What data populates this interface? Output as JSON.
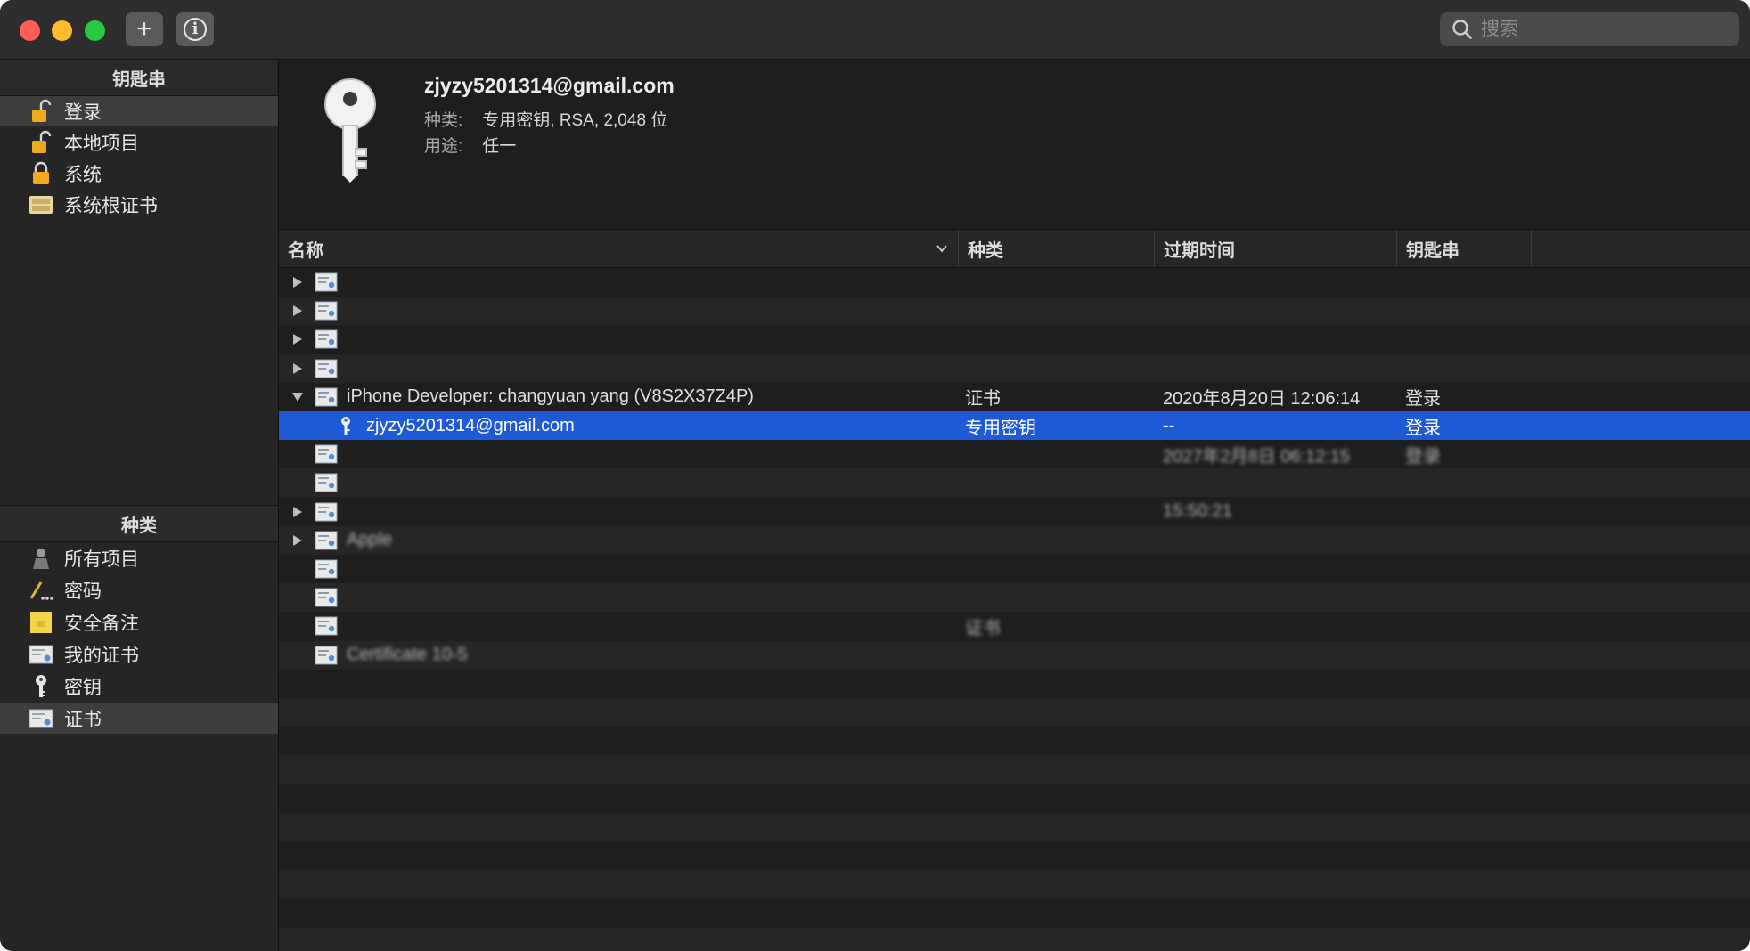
{
  "toolbar": {
    "add_label": "+",
    "info_label": "i",
    "search_placeholder": "搜索"
  },
  "sidebar": {
    "keychains_header": "钥匙串",
    "keychains": [
      {
        "label": "登录",
        "icon": "unlocked-padlock-icon"
      },
      {
        "label": "本地项目",
        "icon": "unlocked-padlock-icon"
      },
      {
        "label": "系统",
        "icon": "locked-padlock-icon"
      },
      {
        "label": "系统根证书",
        "icon": "certificate-cabinet-icon"
      }
    ],
    "categories_header": "种类",
    "categories": [
      {
        "label": "所有项目",
        "icon": "person-icon"
      },
      {
        "label": "密码",
        "icon": "pen-dots-icon"
      },
      {
        "label": "安全备注",
        "icon": "note-icon"
      },
      {
        "label": "我的证书",
        "icon": "certificate-icon"
      },
      {
        "label": "密钥",
        "icon": "key-icon"
      },
      {
        "label": "证书",
        "icon": "certificate-icon"
      }
    ],
    "selected_keychain": "登录",
    "selected_category": "证书"
  },
  "detail": {
    "name": "zjyzy5201314@gmail.com",
    "kind_label": "种类:",
    "kind_value": "专用密钥, RSA, 2,048 位",
    "usage_label": "用途:",
    "usage_value": "任一"
  },
  "table": {
    "columns": [
      "名称",
      "种类",
      "过期时间",
      "钥匙串"
    ],
    "rows": [
      {
        "disclosure": "collapsed",
        "name": "",
        "kind": "",
        "expires": "",
        "keychain": "",
        "blurred": true
      },
      {
        "disclosure": "collapsed",
        "name": "",
        "kind": "",
        "expires": "",
        "keychain": "",
        "blurred": true
      },
      {
        "disclosure": "collapsed",
        "name": "",
        "kind": "",
        "expires": "",
        "keychain": "",
        "blurred": true
      },
      {
        "disclosure": "collapsed",
        "name": "",
        "kind": "",
        "expires": "",
        "keychain": "",
        "blurred": true
      },
      {
        "disclosure": "expanded",
        "name": "iPhone Developer: changyuan yang (V8S2X37Z4P)",
        "kind": "证书",
        "expires": "2020年8月20日 12:06:14",
        "keychain": "登录",
        "blurred": false
      },
      {
        "disclosure": "none",
        "child": true,
        "name": "zjyzy5201314@gmail.com",
        "kind": "专用密钥",
        "expires": "--",
        "keychain": "登录",
        "blurred": false,
        "selected": true
      },
      {
        "disclosure": "none",
        "name": "",
        "kind": "",
        "expires": "2027年2月8日 06:12:15",
        "keychain": "登录",
        "blurred": true
      },
      {
        "disclosure": "none",
        "name": "",
        "kind": "",
        "expires": "",
        "keychain": "",
        "blurred": true
      },
      {
        "disclosure": "collapsed",
        "name": "",
        "kind": "",
        "expires": "15:50:21",
        "keychain": "",
        "blurred": true
      },
      {
        "disclosure": "collapsed",
        "name": "Apple",
        "kind": "",
        "expires": "",
        "keychain": "",
        "blurred": true
      },
      {
        "disclosure": "none",
        "name": "",
        "kind": "",
        "expires": "",
        "keychain": "",
        "blurred": true
      },
      {
        "disclosure": "none",
        "name": "",
        "kind": "",
        "expires": "",
        "keychain": "",
        "blurred": true
      },
      {
        "disclosure": "none",
        "name": "",
        "kind": "证书",
        "expires": "",
        "keychain": "",
        "blurred": true
      },
      {
        "disclosure": "none",
        "name": "Certificate 10-5",
        "kind": "",
        "expires": "",
        "keychain": "",
        "blurred": true
      }
    ]
  },
  "colors": {
    "selection": "#1f5ad6",
    "close": "#ff5f57",
    "minimize": "#febc2e",
    "maximize": "#28c840"
  }
}
